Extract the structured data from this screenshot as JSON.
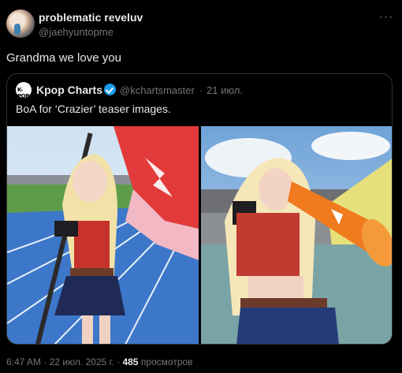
{
  "author": {
    "display_name": "problematic reveluv",
    "handle": "@jaehyuntopme"
  },
  "more_icon": "more-horizontal-icon",
  "tweet_text": "Grandma we love you",
  "quoted": {
    "avatar_text": "K-POP",
    "display_name": "Kpop Charts",
    "verified": true,
    "verified_color": "#1d9bf0",
    "handle": "@kchartsmaster",
    "separator": "·",
    "date": "21 июл.",
    "text": "BoA for ‘Crazier’ teaser images.",
    "images": [
      "teaser-image-1",
      "teaser-image-2"
    ]
  },
  "meta": {
    "time_date": "6:47 AM · 22 июл. 2025 г. ·",
    "views_count": "485",
    "views_label": "просмотров"
  },
  "colors": {
    "background": "#000000",
    "text_primary": "#e7e9ea",
    "text_secondary": "#71767b",
    "border": "#2f3336"
  }
}
